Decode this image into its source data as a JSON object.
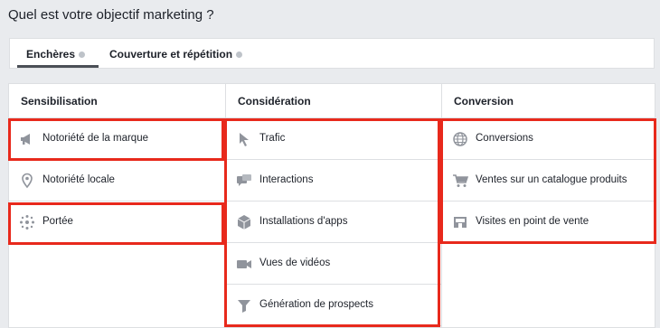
{
  "page": {
    "title": "Quel est votre objectif marketing ?"
  },
  "tabs": [
    {
      "label": "Enchères",
      "active": true
    },
    {
      "label": "Couverture et répétition",
      "active": false
    }
  ],
  "columns": [
    {
      "header": "Sensibilisation",
      "items": [
        {
          "label": "Notoriété de la marque",
          "icon": "megaphone-icon"
        },
        {
          "label": "Notoriété locale",
          "icon": "location-pin-icon"
        },
        {
          "label": "Portée",
          "icon": "reach-icon"
        }
      ]
    },
    {
      "header": "Considération",
      "items": [
        {
          "label": "Trafic",
          "icon": "cursor-icon"
        },
        {
          "label": "Interactions",
          "icon": "chat-icon"
        },
        {
          "label": "Installations d'apps",
          "icon": "app-box-icon"
        },
        {
          "label": "Vues de vidéos",
          "icon": "video-camera-icon"
        },
        {
          "label": "Génération de prospects",
          "icon": "funnel-icon"
        }
      ]
    },
    {
      "header": "Conversion",
      "items": [
        {
          "label": "Conversions",
          "icon": "globe-icon"
        },
        {
          "label": "Ventes sur un catalogue produits",
          "icon": "cart-icon"
        },
        {
          "label": "Visites en point de vente",
          "icon": "store-icon"
        }
      ]
    }
  ],
  "colors": {
    "highlight": "#e8291c",
    "icon": "#90949c",
    "background": "#e9ebee"
  }
}
